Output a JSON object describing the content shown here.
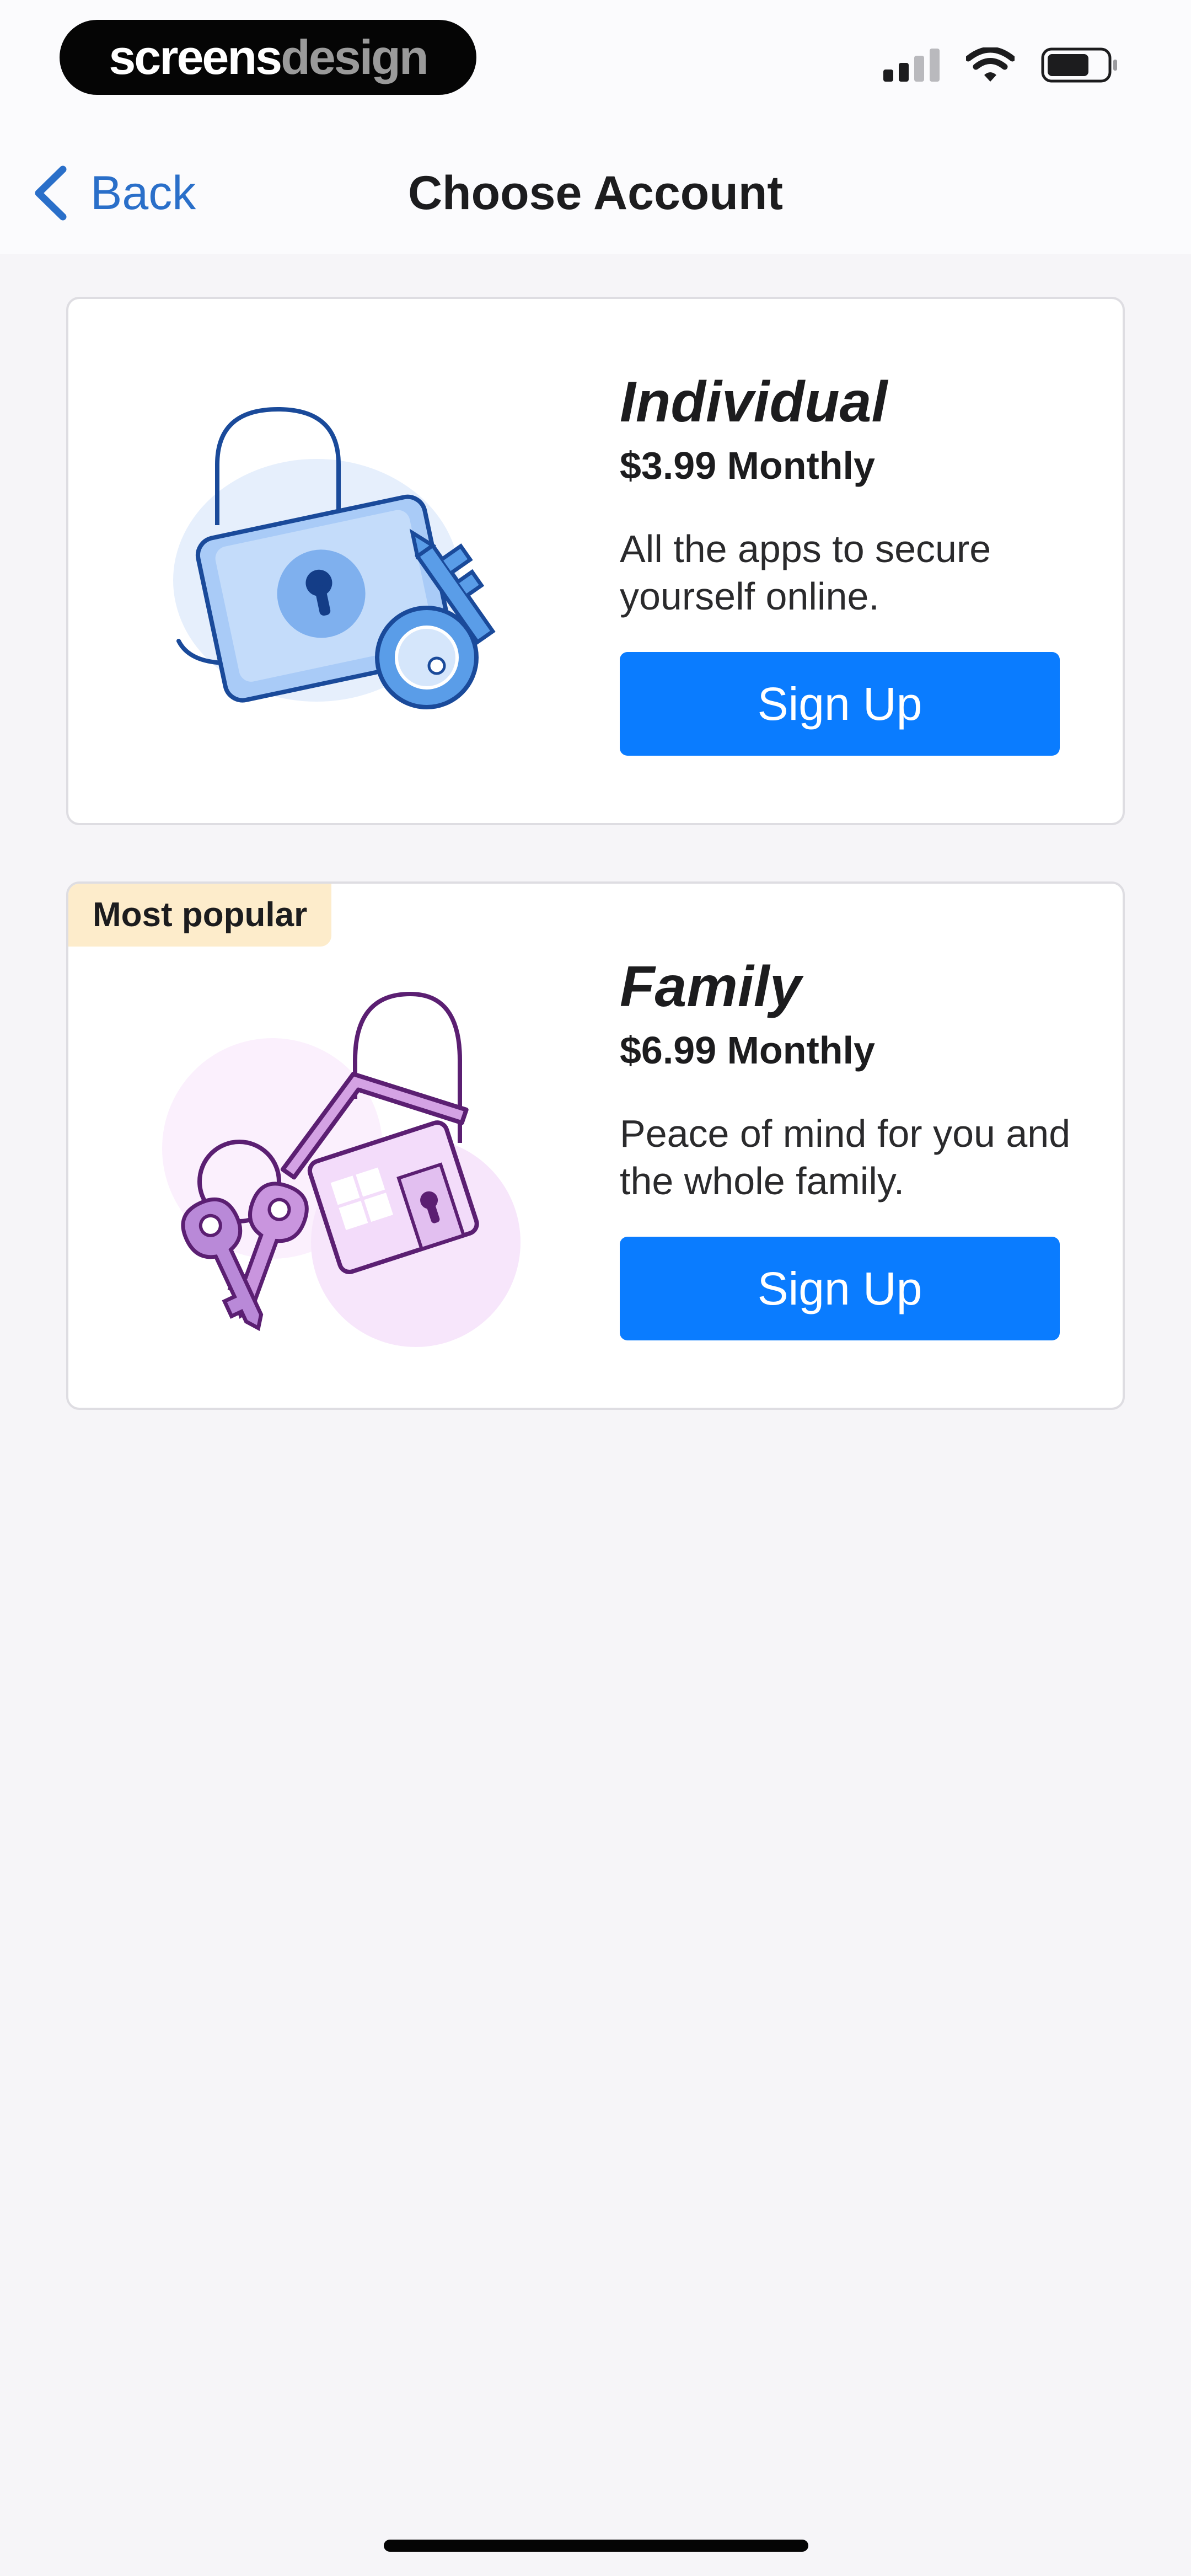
{
  "brand": {
    "part1": "screens",
    "part2": "design"
  },
  "status_bar": {
    "signal_icon": "cellular-signal-icon",
    "wifi_icon": "wifi-icon",
    "battery_icon": "battery-icon"
  },
  "nav": {
    "back_label": "Back",
    "back_icon": "chevron-left-icon",
    "title": "Choose Account"
  },
  "plans": [
    {
      "name": "Individual",
      "price": "$3.99 Monthly",
      "description": "All the apps to secure yourself online.",
      "button_label": "Sign Up",
      "illustration": "padlock-with-key-illustration"
    },
    {
      "badge": "Most popular",
      "name": "Family",
      "price": "$6.99 Monthly",
      "description": "Peace of mind for you and the whole family.",
      "button_label": "Sign Up",
      "illustration": "house-keychain-illustration"
    }
  ],
  "colors": {
    "accent": "#0a7cff",
    "back_link": "#2a6fc9",
    "badge_bg": "#fdeccb",
    "page_bg": "#f6f5f8"
  }
}
